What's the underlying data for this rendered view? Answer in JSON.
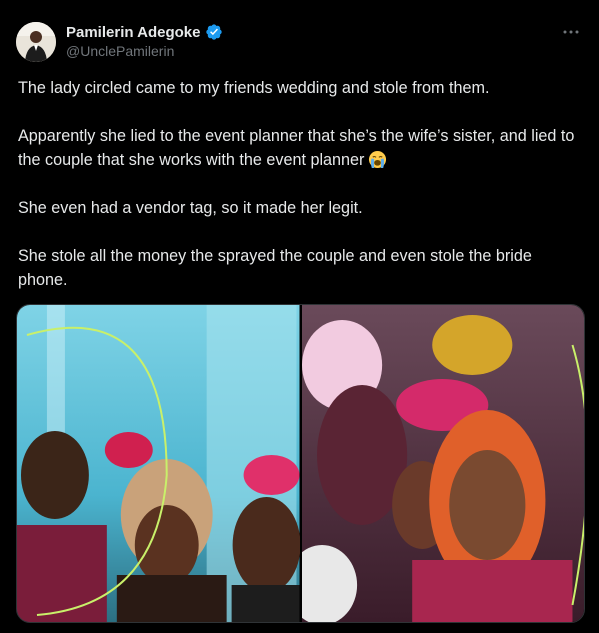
{
  "tweet": {
    "author": {
      "display_name": "Pamilerin Adegoke",
      "handle": "@UnclePamilerin",
      "verified": true,
      "avatar_icon": "profile-avatar"
    },
    "more_icon": "more-options-icon",
    "paragraphs": [
      "The lady circled came to my friends wedding and stole from them.",
      "Apparently she lied to the event planner that she’s the wife’s sister, and lied to the couple that she works with the event planner",
      "She even had a vendor tag, so it made her legit.",
      "She stole all the money the sprayed the couple and even stole the bride phone."
    ],
    "emoji": "loudly-crying-face-emoji",
    "media": [
      {
        "name": "wedding-photo-left",
        "description_icon": "photo"
      },
      {
        "name": "wedding-photo-right",
        "description_icon": "photo"
      }
    ]
  },
  "colors": {
    "background": "#000000",
    "text": "#e7e9ea",
    "secondary_text": "#71767b",
    "verified_blue": "#1d9bf0",
    "border": "#2f3336"
  }
}
